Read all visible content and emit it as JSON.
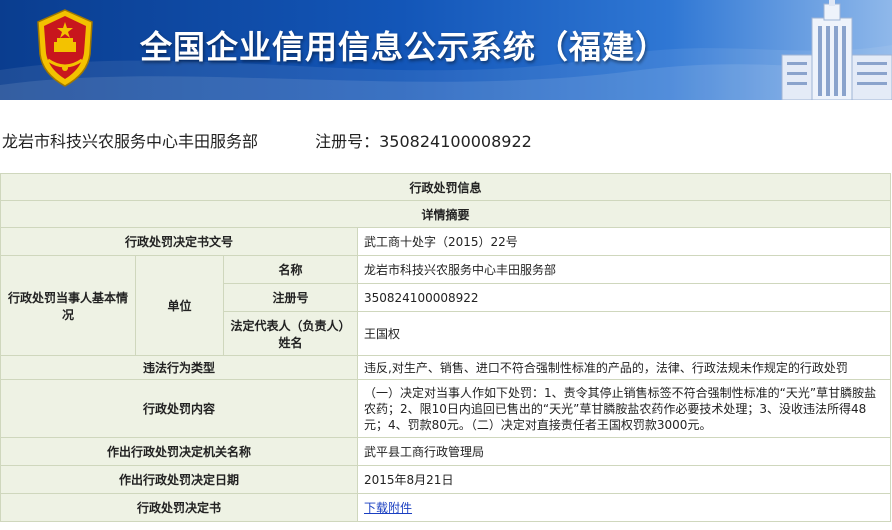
{
  "header": {
    "title": "全国企业信用信息公示系统（福建）",
    "colors": {
      "banner_dark": "#0a3d8f",
      "banner_light": "#8fb8ea",
      "emblem_red": "#c8161d",
      "emblem_gold": "#f3c200"
    }
  },
  "entity": {
    "name": "龙岩市科技兴农服务中心丰田服务部",
    "reg_label": "注册号：",
    "reg_number": "350824100008922"
  },
  "record": {
    "section_title": "行政处罚信息",
    "subsection_title": "详情摘要",
    "decision_no_label": "行政处罚决定书文号",
    "decision_no": "武工商十处字（2015）22号",
    "party_label": "行政处罚当事人基本情况",
    "unit_label": "单位",
    "name_label": "名称",
    "name_value": "龙岩市科技兴农服务中心丰田服务部",
    "reg_label": "注册号",
    "reg_value": "350824100008922",
    "rep_label": "法定代表人（负责人）姓名",
    "rep_value": "王国权",
    "violation_type_label": "违法行为类型",
    "violation_type": "违反,对生产、销售、进口不符合强制性标准的产品的，法律、行政法规未作规定的行政处罚",
    "content_label": "行政处罚内容",
    "content": "（一）决定对当事人作如下处罚：1、责令其停止销售标签不符合强制性标准的“天光”草甘膦胺盐农药；2、限10日内追回已售出的“天光”草甘膦胺盐农药作必要技术处理；3、没收违法所得48元；4、罚款80元。（二）决定对直接责任者王国权罚款3000元。",
    "authority_label": "作出行政处罚决定机关名称",
    "authority": "武平县工商行政管理局",
    "date_label": "作出行政处罚决定日期",
    "date": "2015年8月21日",
    "document_label": "行政处罚决定书",
    "document_link": "下载附件"
  }
}
